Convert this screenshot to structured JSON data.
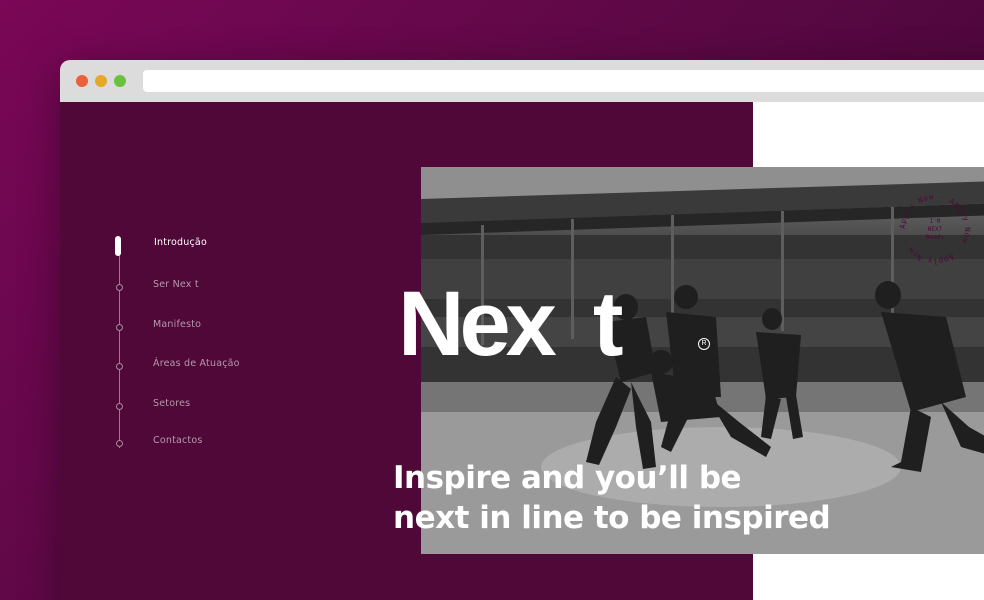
{
  "browser": {
    "url": ""
  },
  "nav": {
    "items": [
      {
        "label": "Introdução",
        "active": true
      },
      {
        "label": "Ser Nex t",
        "active": false
      },
      {
        "label": "Manifesto",
        "active": false
      },
      {
        "label": "Áreas de Atuação",
        "active": false
      },
      {
        "label": "Setores",
        "active": false
      },
      {
        "label": "Contactos",
        "active": false
      }
    ]
  },
  "hero": {
    "logo": "Nex  t",
    "registered_mark": "R",
    "headline_line1": "Inspire and you’ll be",
    "headline_line2": "next in line to be inspired"
  },
  "badge": {
    "ring_text": "Apply Now · Apply Now · Apply Now ·",
    "center_line1": "I'M",
    "center_line2": "NEXT",
    "center_line3": "Ready"
  },
  "colors": {
    "brand_purple": "#4f0838",
    "background_magenta": "#7a0757",
    "white": "#ffffff"
  }
}
